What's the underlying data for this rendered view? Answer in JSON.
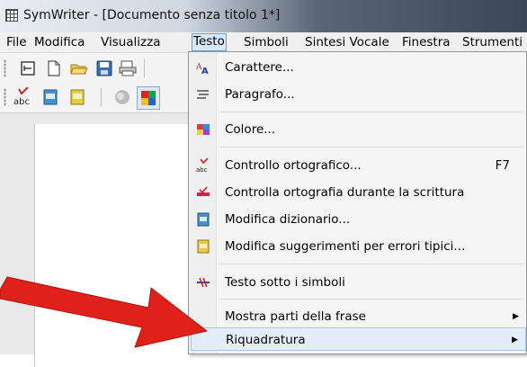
{
  "window": {
    "title": "SymWriter - [Documento senza titolo 1*]"
  },
  "menubar": {
    "items": [
      "File",
      "Modifica",
      "Visualizza",
      "Testo",
      "Simboli",
      "Sintesi Vocale",
      "Finestra",
      "Strumenti"
    ],
    "active": "Testo"
  },
  "toolbar": {
    "row1": [
      "new-page-icon",
      "new-document-icon",
      "open-folder-icon",
      "save-disk-icon",
      "print-icon"
    ],
    "row2": [
      "spellcheck-icon",
      "dictionary-icon",
      "suggestions-icon",
      "speech-icon",
      "color-blocks-icon"
    ]
  },
  "text_menu": {
    "items": [
      {
        "label": "Carattere...",
        "icon": "font-icon"
      },
      {
        "label": "Paragrafo...",
        "icon": "paragraph-icon"
      },
      {
        "label": "Colore...",
        "icon": "color-icon"
      },
      {
        "label": "Controllo ortografico...",
        "shortcut": "F7",
        "icon": "spellcheck-icon"
      },
      {
        "label": "Controlla ortografia durante la scrittura",
        "icon": "live-spellcheck-icon"
      },
      {
        "label": "Modifica dizionario...",
        "icon": "dictionary-icon"
      },
      {
        "label": "Modifica suggerimenti per errori tipici...",
        "icon": "suggestions-icon"
      },
      {
        "label": "Testo sotto i simboli",
        "icon": "text-below-symbols-icon"
      },
      {
        "label": "Mostra parti della frase",
        "submenu": true
      },
      {
        "label": "Riquadratura",
        "submenu": true
      }
    ],
    "highlighted": "Riquadratura"
  },
  "annotation": {
    "color": "#e0201b",
    "shape": "red-arrow"
  },
  "colors": {
    "menu_highlight": "#d6e8fa",
    "menu_bg": "#f5f5f5",
    "menubar_bg": "#f0f0f0"
  }
}
